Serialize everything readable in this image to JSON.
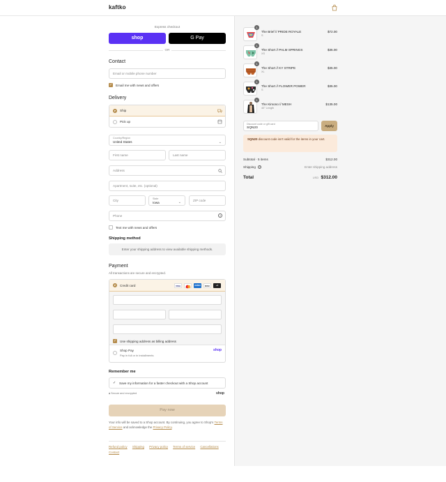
{
  "header": {
    "logo": "kaftko",
    "cart_icon": "shopping-bag-icon"
  },
  "express": {
    "title": "Express checkout",
    "shop_pay": "shop",
    "google_pay": "G Pay",
    "or": "OR"
  },
  "contact": {
    "heading": "Contact",
    "email_placeholder": "Email or mobile phone number",
    "news_label": "Email me with news and offers",
    "news_checked": true
  },
  "delivery": {
    "heading": "Delivery",
    "ship_label": "Ship",
    "pickup_label": "Pick up",
    "country_label": "Country/Region",
    "country_value": "United States",
    "first_name": "First name",
    "last_name": "Last name",
    "address": "Address",
    "apartment": "Apartment, suite, etc. (optional)",
    "city": "City",
    "state_label": "State",
    "state_value": "Iowa",
    "zip": "ZIP code",
    "phone": "Phone",
    "text_label": "Text me with news and offers"
  },
  "shipping_method": {
    "heading": "Shipping method",
    "message": "Enter your shipping address to view available shipping methods."
  },
  "payment": {
    "heading": "Payment",
    "subtitle": "All transactions are secure and encrypted.",
    "credit_card": "Credit card",
    "cards": [
      "VISA",
      "MC",
      "AMEX",
      "DISC",
      "+4"
    ],
    "billing_label": "Use shipping address as billing address",
    "shop_pay_title": "Shop Pay",
    "shop_pay_sub": "Pay in full or in installments",
    "shop_pay_logo": "shop"
  },
  "remember": {
    "heading": "Remember me",
    "label": "Save my information for a faster checkout with a Shop account",
    "secure": "Secure and encrypted",
    "shop_logo": "shop"
  },
  "pay_now": "Pay now",
  "legal": {
    "line1": "Your info will be saved to a Shop account. By continuing, you agree to Shop’s",
    "terms": "Terms of Service",
    "and": "and acknowledge the",
    "privacy": "Privacy Policy",
    "dot": "."
  },
  "footer": [
    "Refund policy",
    "Shipping",
    "Privacy policy",
    "Terms of service",
    "Cancellations",
    "Contact"
  ],
  "cart": {
    "items": [
      {
        "name": "The Brief // PRIDE ROYALE",
        "variant": "S",
        "price": "$72.00",
        "qty": "1"
      },
      {
        "name": "The Short // PALM SPRINGS",
        "variant": "XS",
        "price": "$35.00",
        "qty": "1"
      },
      {
        "name": "The Short // KY STRIPE",
        "variant": "XL",
        "price": "$35.00",
        "qty": "1"
      },
      {
        "name": "The Short // FLOWER POWER",
        "variant": "S",
        "price": "$35.00",
        "qty": "1"
      },
      {
        "name": "The Kimono // MESH",
        "variant": "40\" Length",
        "price": "$135.00",
        "qty": "1"
      }
    ],
    "discount_label": "Discount code or gift card",
    "discount_value": "SQN20",
    "apply": "Apply",
    "warning_code": "SQN20",
    "warning_text": "discount code isn't valid for the items in your cart.",
    "subtotal_label": "Subtotal · 5 items",
    "subtotal_value": "$312.00",
    "shipping_label": "Shipping",
    "shipping_value": "Enter shipping address",
    "total_label": "Total",
    "currency": "USD",
    "total_value": "$312.00"
  },
  "colors": {
    "accent": "#b58c4c",
    "shop_purple": "#5a31f4",
    "warn_bg": "#fbeadb"
  }
}
